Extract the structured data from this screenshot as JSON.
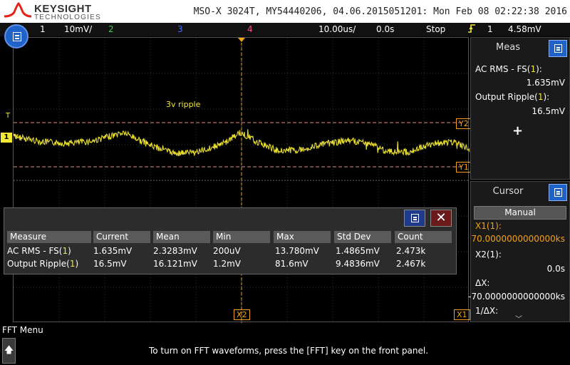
{
  "header": {
    "brand": "KEYSIGHT",
    "brand_sub": "TECHNOLOGIES",
    "model_info": "MSO-X 3024T, MY54440206, 04.06.2015051201: Mon Feb 08 02:22:38 2016"
  },
  "statusbar": {
    "ch1_num": "1",
    "ch1_scale": "10mV/",
    "ch2_num": "2",
    "ch3_num": "3",
    "ch4_num": "4",
    "timebase": "10.00us/",
    "delay": "0.0s",
    "run_state": "Stop",
    "trigger_icon": "trigger-rising-edge-icon",
    "trigger_source": "1",
    "trigger_level": "4.58mV"
  },
  "colors": {
    "ch1": "#f3e833",
    "ch2": "#37d24a",
    "ch3": "#4b6bff",
    "ch4": "#ff4a8d",
    "cursor": "#f3a21b",
    "menu_blue": "#1f62c9"
  },
  "plot": {
    "annotation": "3v ripple",
    "markers": {
      "y1": "Y1",
      "y2": "Y2",
      "x1": "X1",
      "x2": "X2",
      "trigger_level": "T",
      "ch1_ground": "1",
      "ch1_arrow": "V"
    }
  },
  "meas_panel": {
    "title": "Meas",
    "item1_label_prefix": "AC RMS - FS(",
    "item1_label_ch": "1",
    "item1_label_suffix": "):",
    "item1_value": "1.635mV",
    "item2_label_prefix": "Output Ripple(",
    "item2_label_ch": "1",
    "item2_label_suffix": "):",
    "item2_value": "16.5mV",
    "add_symbol": "+"
  },
  "cursor_panel": {
    "title": "Cursor",
    "mode": "Manual",
    "x1_label": "X1(1):",
    "x1_value": "70.0000000000000ks",
    "x2_label": "X2(1):",
    "x2_value": "0.0s",
    "dx_label": "ΔX:",
    "dx_value": "-70.0000000000000ks",
    "inv_dx_label": "1/ΔX:",
    "scroll_symbol": "﹀"
  },
  "meas_table": {
    "close_symbol": "✕",
    "headers": [
      "Measure",
      "Current",
      "Mean",
      "Min",
      "Max",
      "Std Dev",
      "Count"
    ],
    "rows": [
      {
        "name_prefix": "AC RMS - FS(",
        "name_ch": "1",
        "name_suffix": ")",
        "current": "1.635mV",
        "mean": "2.3283mV",
        "min": "200uV",
        "max": "13.780mV",
        "stddev": "1.4865mV",
        "count": "2.473k"
      },
      {
        "name_prefix": "Output Ripple(",
        "name_ch": "1",
        "name_suffix": ")",
        "current": "16.5mV",
        "mean": "16.121mV",
        "min": "1.2mV",
        "max": "81.6mV",
        "stddev": "9.4836mV",
        "count": "2.467k"
      }
    ]
  },
  "bottom": {
    "menu_title": "FFT Menu",
    "up_symbol": "🡅",
    "message": "To turn on FFT waveforms, press the [FFT] key on the front panel."
  }
}
